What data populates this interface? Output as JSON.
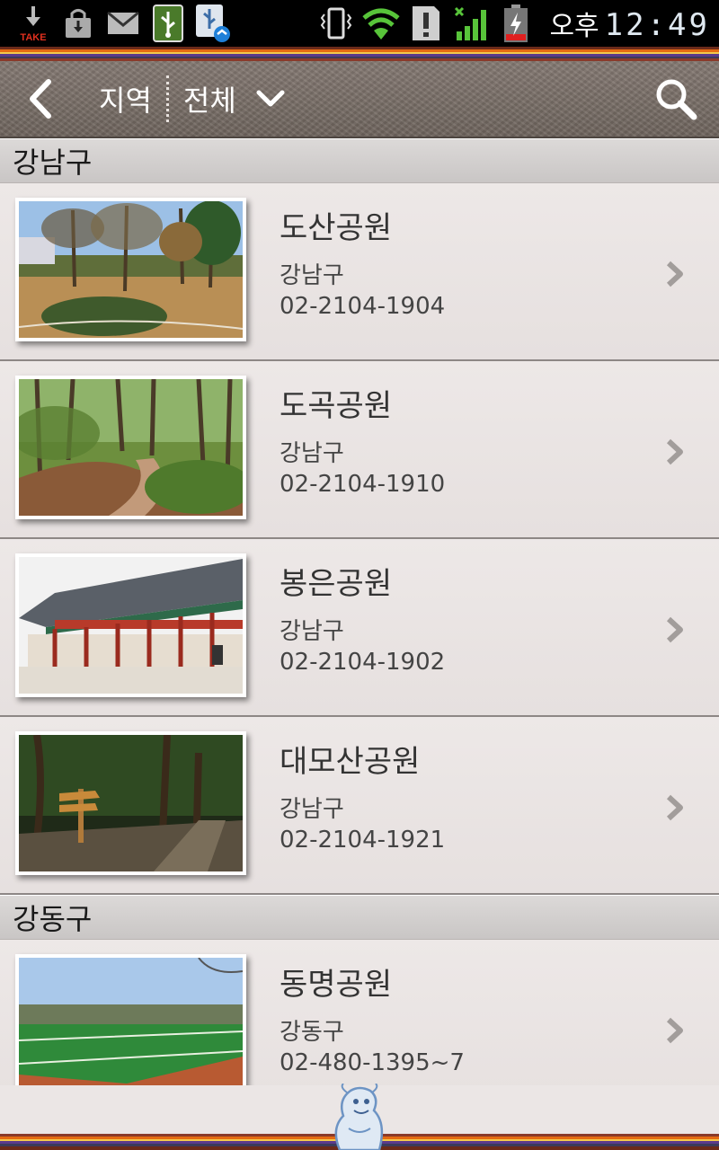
{
  "status_bar": {
    "take_label": "TAKE",
    "ampm": "오후",
    "time": "12:49",
    "icons": [
      "download-take-icon",
      "download-bag-icon",
      "gmail-icon",
      "usb-icon",
      "usb-debug-icon",
      "vibrate-icon",
      "wifi-icon",
      "alert-icon",
      "signal-icon",
      "battery-charging-icon"
    ]
  },
  "header": {
    "back_icon": "chevron-left-icon",
    "region_label": "지역",
    "region_value": "전체",
    "dropdown_icon": "chevron-down-icon",
    "search_icon": "search-icon"
  },
  "sections": [
    {
      "title": "강남구",
      "parks": [
        {
          "name": "도산공원",
          "district": "강남구",
          "phone": "02-2104-1904"
        },
        {
          "name": "도곡공원",
          "district": "강남구",
          "phone": "02-2104-1910"
        },
        {
          "name": "봉은공원",
          "district": "강남구",
          "phone": "02-2104-1902"
        },
        {
          "name": "대모산공원",
          "district": "강남구",
          "phone": "02-2104-1921"
        }
      ]
    },
    {
      "title": "강동구",
      "parks": [
        {
          "name": "동명공원",
          "district": "강동구",
          "phone": "02-480-1395~7"
        }
      ]
    }
  ],
  "colors": {
    "header_bg": "#7a706a",
    "list_bg": "#ebe6e5",
    "section_bg": "#d3d0cf",
    "divider": "#8d8785"
  }
}
